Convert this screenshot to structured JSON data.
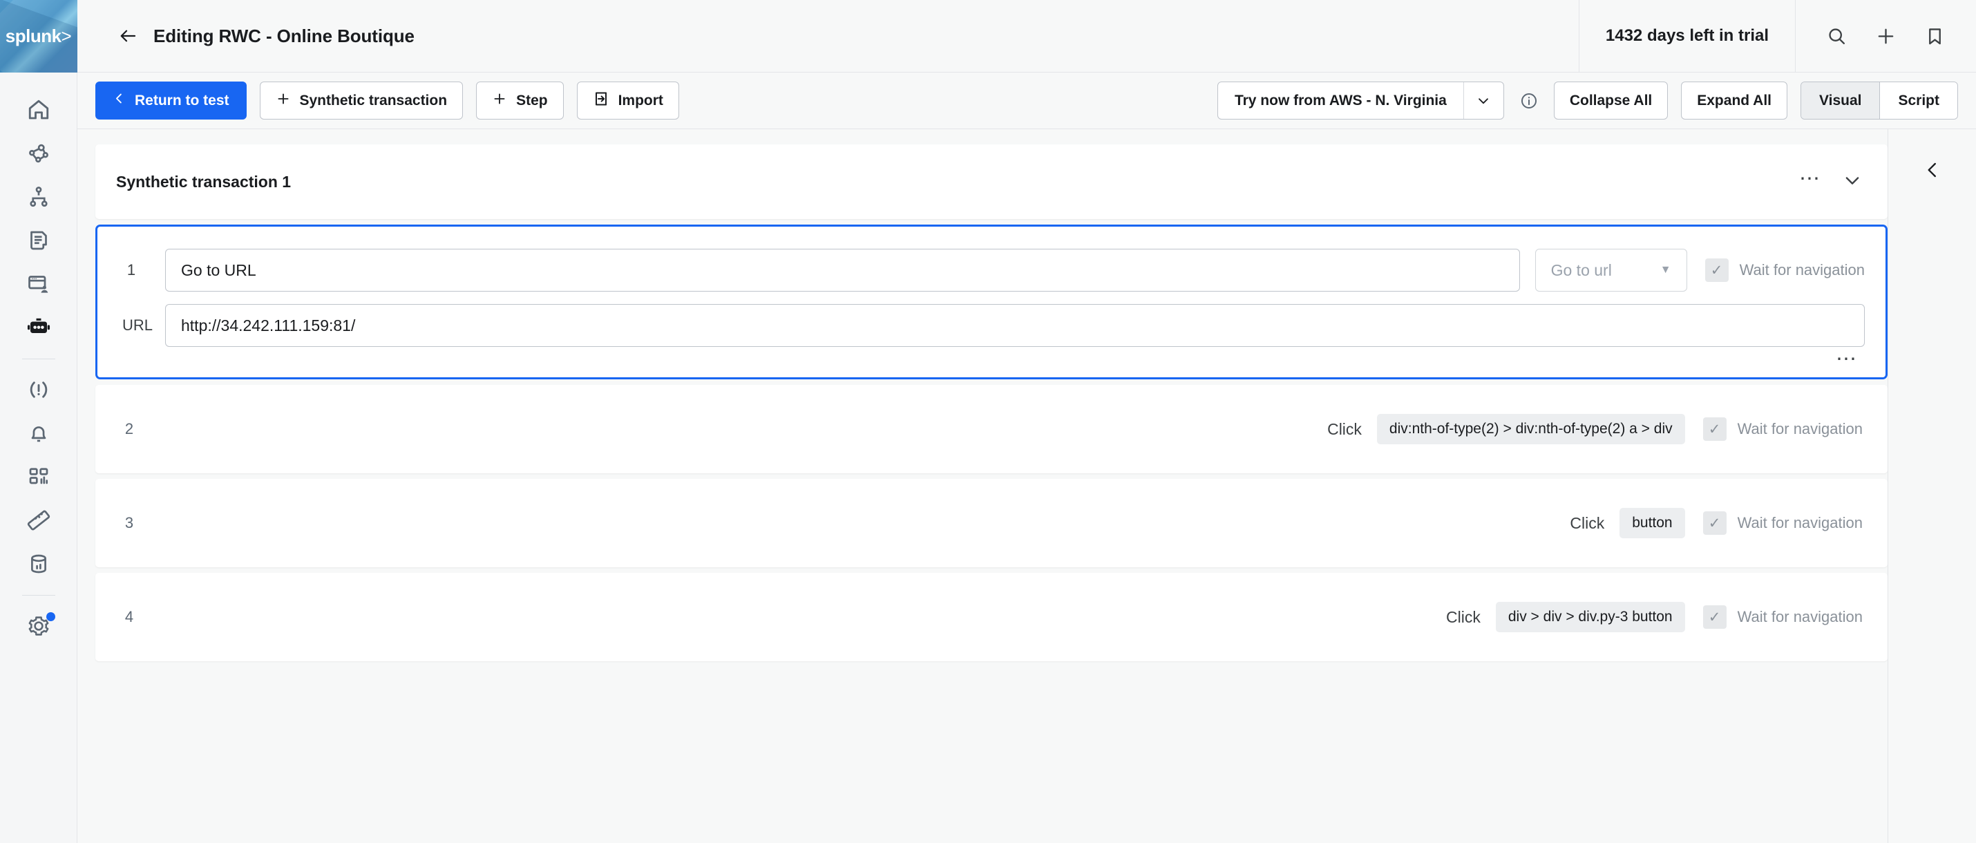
{
  "brand": {
    "logo_text": "splunk",
    "logo_suffix": ">"
  },
  "header": {
    "back_icon": "arrow-left-icon",
    "title": "Editing RWC - Online Boutique",
    "trial_text": "1432 days left in trial",
    "icons": [
      "search-icon",
      "plus-icon",
      "bookmark-icon"
    ]
  },
  "sidebar": {
    "items": [
      {
        "name": "home",
        "icon": "home-icon"
      },
      {
        "name": "infrastructure",
        "icon": "infrastructure-nodes-icon"
      },
      {
        "name": "apm",
        "icon": "service-hierarchy-icon"
      },
      {
        "name": "log-observer",
        "icon": "document-log-icon"
      },
      {
        "name": "rum",
        "icon": "browser-user-icon"
      },
      {
        "name": "synthetics",
        "icon": "robot-icon"
      },
      {
        "name": "incidents",
        "icon": "alert-parenthesis-icon"
      },
      {
        "name": "alerts",
        "icon": "bell-icon"
      },
      {
        "name": "dashboards",
        "icon": "dashboard-grid-icon"
      },
      {
        "name": "metrics",
        "icon": "ruler-icon"
      },
      {
        "name": "data-management",
        "icon": "database-icon"
      },
      {
        "name": "settings",
        "icon": "gear-icon",
        "badge": true
      }
    ]
  },
  "toolbar": {
    "return_label": "Return to test",
    "return_icon": "chevron-left-icon",
    "synthetic_transaction_label": "Synthetic transaction",
    "synthetic_transaction_icon": "plus-icon",
    "step_label": "Step",
    "step_icon": "plus-icon",
    "import_label": "Import",
    "import_icon": "import-arrow-icon",
    "location_label": "Try now from AWS - N. Virginia",
    "location_caret_icon": "chevron-down-icon",
    "info_icon": "info-circle-icon",
    "collapse_all_label": "Collapse All",
    "expand_all_label": "Expand All",
    "view_modes": [
      {
        "label": "Visual",
        "selected": true
      },
      {
        "label": "Script",
        "selected": false
      }
    ]
  },
  "transaction": {
    "title": "Synthetic transaction 1",
    "kebab_icon": "more-horizontal-icon",
    "collapse_icon": "chevron-down-icon"
  },
  "steps": [
    {
      "number": "1",
      "expanded": true,
      "action_value": "Go to URL",
      "type_value": "Go to url",
      "type_caret_icon": "caret-down-icon",
      "wait_label": "Wait for navigation",
      "wait_checked": true,
      "check_icon": "check-icon",
      "url_label": "URL",
      "url_value": "http://34.242.111.159:81/",
      "footer_kebab_icon": "more-horizontal-icon"
    },
    {
      "number": "2",
      "expanded": false,
      "action_label": "Click",
      "selector": "div:nth-of-type(2) > div:nth-of-type(2) a > div",
      "wait_label": "Wait for navigation",
      "wait_checked": true,
      "check_icon": "check-icon"
    },
    {
      "number": "3",
      "expanded": false,
      "action_label": "Click",
      "selector": "button",
      "wait_label": "Wait for navigation",
      "wait_checked": true,
      "check_icon": "check-icon"
    },
    {
      "number": "4",
      "expanded": false,
      "action_label": "Click",
      "selector": "div > div > div.py-3 button",
      "wait_label": "Wait for navigation",
      "wait_checked": true,
      "check_icon": "check-icon"
    }
  ],
  "right_panel": {
    "collapse_icon": "chevron-left-icon"
  },
  "colors": {
    "accent": "#1866f2",
    "page_bg": "#f7f8f8",
    "card_bg": "#ffffff",
    "text": "#1a1c1f",
    "muted": "#8a9199",
    "chip_bg": "#eceef0"
  }
}
